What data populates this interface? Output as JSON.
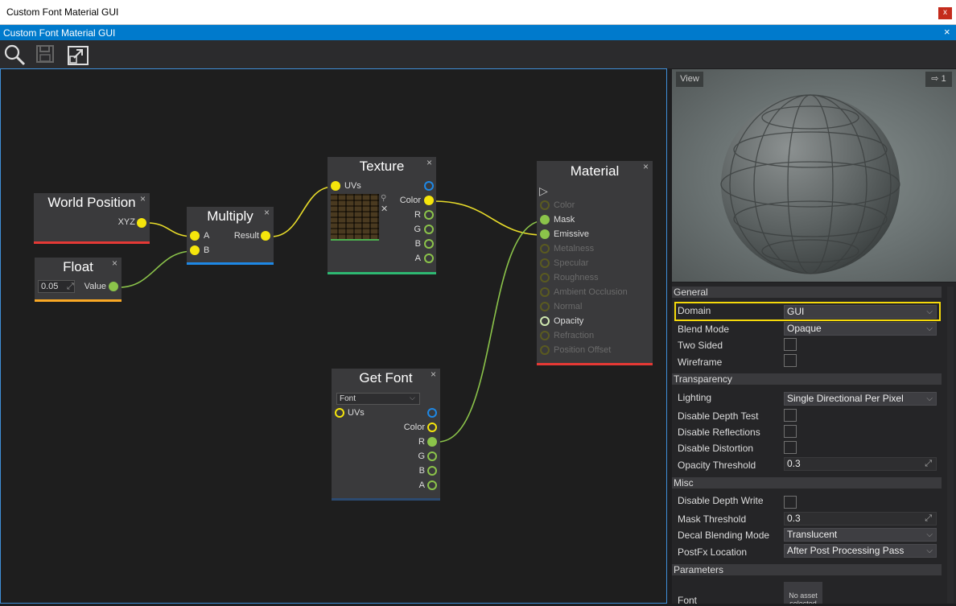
{
  "window": {
    "title": "Custom Font Material GUI",
    "close": "x"
  },
  "tab": {
    "title": "Custom Font Material GUI",
    "close": "×"
  },
  "nodes": {
    "world_position": {
      "title": "World Position",
      "close": "×",
      "outputs": [
        "XYZ"
      ]
    },
    "float": {
      "title": "Float",
      "close": "×",
      "value": "0.05",
      "value_icon": "⤢",
      "output": "Value"
    },
    "multiply": {
      "title": "Multiply",
      "close": "×",
      "inputs": [
        "A",
        "B"
      ],
      "output": "Result"
    },
    "texture": {
      "title": "Texture",
      "close": "×",
      "input": "UVs",
      "outputs": [
        "Color",
        "R",
        "G",
        "B",
        "A"
      ]
    },
    "material": {
      "title": "Material",
      "close": "×",
      "inputs": [
        {
          "label": "Color",
          "active": false
        },
        {
          "label": "Mask",
          "active": true
        },
        {
          "label": "Emissive",
          "active": true
        },
        {
          "label": "Metalness",
          "active": false
        },
        {
          "label": "Specular",
          "active": false
        },
        {
          "label": "Roughness",
          "active": false
        },
        {
          "label": "Ambient Occlusion",
          "active": false
        },
        {
          "label": "Normal",
          "active": false
        },
        {
          "label": "Opacity",
          "active": true
        },
        {
          "label": "Refraction",
          "active": false
        },
        {
          "label": "Position Offset",
          "active": false
        }
      ]
    },
    "get_font": {
      "title": "Get Font",
      "close": "×",
      "font_select": "Font",
      "input": "UVs",
      "outputs": [
        "Color",
        "R",
        "G",
        "B",
        "A"
      ]
    }
  },
  "preview": {
    "view_button": "View",
    "camera_count": "1"
  },
  "properties": {
    "general": {
      "header": "General",
      "domain_label": "Domain",
      "domain_value": "GUI",
      "blend_mode_label": "Blend Mode",
      "blend_mode_value": "Opaque",
      "two_sided_label": "Two Sided",
      "wireframe_label": "Wireframe"
    },
    "transparency": {
      "header": "Transparency",
      "lighting_label": "Lighting",
      "lighting_value": "Single Directional Per Pixel",
      "disable_depth_test_label": "Disable Depth Test",
      "disable_reflections_label": "Disable Reflections",
      "disable_distortion_label": "Disable Distortion",
      "opacity_threshold_label": "Opacity Threshold",
      "opacity_threshold_value": "0.3"
    },
    "misc": {
      "header": "Misc",
      "disable_depth_write_label": "Disable Depth Write",
      "mask_threshold_label": "Mask Threshold",
      "mask_threshold_value": "0.3",
      "decal_blending_mode_label": "Decal Blending Mode",
      "decal_blending_mode_value": "Translucent",
      "postfx_location_label": "PostFx Location",
      "postfx_location_value": "After Post Processing Pass"
    },
    "parameters": {
      "header": "Parameters",
      "font_label": "Font",
      "asset_text": "No asset selected"
    }
  },
  "colors": {
    "accent": "#007acc",
    "wire_yellow": "#f5e50c",
    "wire_green": "#8bc34a",
    "domain_highlight": "#f5d90a"
  }
}
